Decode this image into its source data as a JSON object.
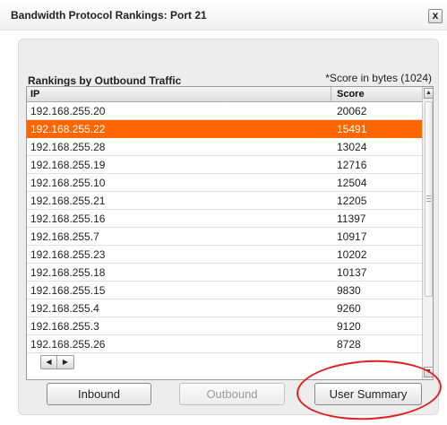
{
  "window": {
    "title": "Bandwidth Protocol Rankings: Port 21",
    "close_label": "x"
  },
  "panel": {
    "heading": "Rankings by Outbound Traffic",
    "note": "*Score in bytes (1024)"
  },
  "table": {
    "columns": [
      "IP",
      "Score"
    ],
    "selected_ip": "192.168.255.22",
    "rows": [
      {
        "ip": "192.168.255.20",
        "score": "20062"
      },
      {
        "ip": "192.168.255.22",
        "score": "15491"
      },
      {
        "ip": "192.168.255.28",
        "score": "13024"
      },
      {
        "ip": "192.168.255.19",
        "score": "12716"
      },
      {
        "ip": "192.168.255.10",
        "score": "12504"
      },
      {
        "ip": "192.168.255.21",
        "score": "12205"
      },
      {
        "ip": "192.168.255.16",
        "score": "11397"
      },
      {
        "ip": "192.168.255.7",
        "score": "10917"
      },
      {
        "ip": "192.168.255.23",
        "score": "10202"
      },
      {
        "ip": "192.168.255.18",
        "score": "10137"
      },
      {
        "ip": "192.168.255.15",
        "score": "9830"
      },
      {
        "ip": "192.168.255.4",
        "score": "9260"
      },
      {
        "ip": "192.168.255.3",
        "score": "9120"
      },
      {
        "ip": "192.168.255.26",
        "score": "8728"
      }
    ]
  },
  "buttons": {
    "inbound": "Inbound",
    "outbound": "Outbound",
    "user_summary": "User Summary"
  },
  "colors": {
    "selection": "#ff6600",
    "annotation": "#e02020"
  }
}
